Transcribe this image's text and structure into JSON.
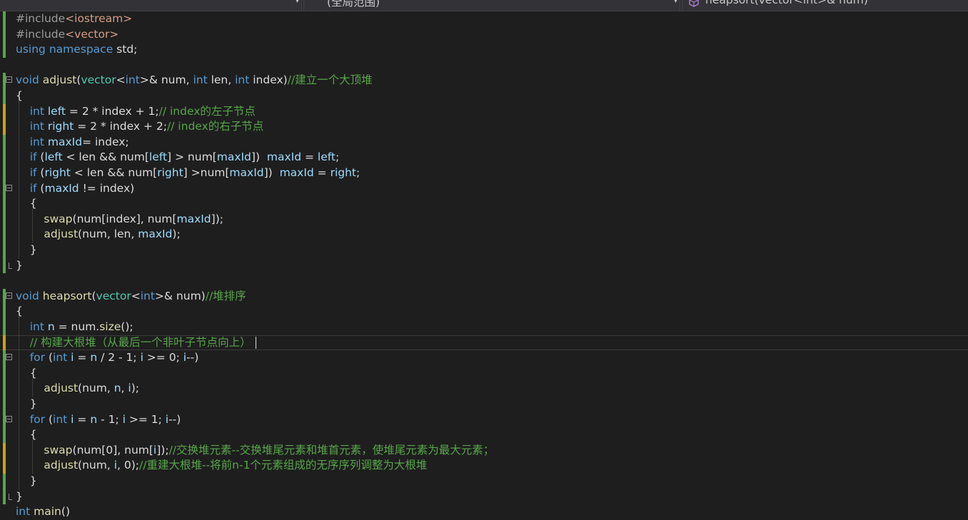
{
  "nav": {
    "scope": "(全局范围)",
    "function": "heapsort(vector<int>& num)"
  },
  "colors": {
    "background": "#1e1e1e",
    "keyword": "#569cd6",
    "type": "#4ec9b0",
    "function": "#dcdcaa",
    "comment": "#57a64a",
    "string": "#d69d85",
    "preprocessor": "#9b9b9b",
    "variable": "#9cdcfe"
  },
  "code_lines": [
    [
      [
        "pp",
        "#include"
      ],
      [
        "st",
        "<iostream>"
      ]
    ],
    [
      [
        "pp",
        "#include"
      ],
      [
        "st",
        "<vector>"
      ]
    ],
    [
      [
        "kw",
        "using"
      ],
      [
        "pl",
        " "
      ],
      [
        "kw",
        "namespace"
      ],
      [
        "pl",
        " std;"
      ]
    ],
    [],
    [
      [
        "kw",
        "void"
      ],
      [
        "pl",
        " "
      ],
      [
        "fn",
        "adjust"
      ],
      [
        "pl",
        "("
      ],
      [
        "ty",
        "vector"
      ],
      [
        "pl",
        "<"
      ],
      [
        "kw",
        "int"
      ],
      [
        "pl",
        ">& num, "
      ],
      [
        "kw",
        "int"
      ],
      [
        "pl",
        " len, "
      ],
      [
        "kw",
        "int"
      ],
      [
        "pl",
        " index)"
      ],
      [
        "cm",
        "//建立一个大顶堆"
      ]
    ],
    [
      [
        "pl",
        "{"
      ]
    ],
    [
      [
        "pl",
        "    "
      ],
      [
        "kw",
        "int"
      ],
      [
        "pl",
        " "
      ],
      [
        "vr",
        "left"
      ],
      [
        "pl",
        " = 2 * index + 1;"
      ],
      [
        "cm",
        "// index的左子节点"
      ]
    ],
    [
      [
        "pl",
        "    "
      ],
      [
        "kw",
        "int"
      ],
      [
        "pl",
        " "
      ],
      [
        "vr",
        "right"
      ],
      [
        "pl",
        " = 2 * index + 2;"
      ],
      [
        "cm",
        "// index的右子节点"
      ]
    ],
    [
      [
        "pl",
        "    "
      ],
      [
        "kw",
        "int"
      ],
      [
        "pl",
        " "
      ],
      [
        "vr",
        "maxId"
      ],
      [
        "pl",
        "= index;"
      ]
    ],
    [
      [
        "pl",
        "    "
      ],
      [
        "kw",
        "if"
      ],
      [
        "pl",
        " ("
      ],
      [
        "vr",
        "left"
      ],
      [
        "pl",
        " < len && num["
      ],
      [
        "vr",
        "left"
      ],
      [
        "pl",
        "] > num["
      ],
      [
        "vr",
        "maxId"
      ],
      [
        "pl",
        "])  "
      ],
      [
        "vr",
        "maxId"
      ],
      [
        "pl",
        " = "
      ],
      [
        "vr",
        "left"
      ],
      [
        "pl",
        ";"
      ]
    ],
    [
      [
        "pl",
        "    "
      ],
      [
        "kw",
        "if"
      ],
      [
        "pl",
        " ("
      ],
      [
        "vr",
        "right"
      ],
      [
        "pl",
        " < len && num["
      ],
      [
        "vr",
        "right"
      ],
      [
        "pl",
        "] >num["
      ],
      [
        "vr",
        "maxId"
      ],
      [
        "pl",
        "])  "
      ],
      [
        "vr",
        "maxId"
      ],
      [
        "pl",
        " = "
      ],
      [
        "vr",
        "right"
      ],
      [
        "pl",
        ";"
      ]
    ],
    [
      [
        "pl",
        "    "
      ],
      [
        "kw",
        "if"
      ],
      [
        "pl",
        " ("
      ],
      [
        "vr",
        "maxId"
      ],
      [
        "pl",
        " != index)"
      ]
    ],
    [
      [
        "pl",
        "    {"
      ]
    ],
    [
      [
        "pl",
        "        "
      ],
      [
        "fn",
        "swap"
      ],
      [
        "pl",
        "(num[index], num["
      ],
      [
        "vr",
        "maxId"
      ],
      [
        "pl",
        "]);"
      ]
    ],
    [
      [
        "pl",
        "        "
      ],
      [
        "fn",
        "adjust"
      ],
      [
        "pl",
        "(num, len, "
      ],
      [
        "vr",
        "maxId"
      ],
      [
        "pl",
        ");"
      ]
    ],
    [
      [
        "pl",
        "    }"
      ]
    ],
    [
      [
        "pl",
        "}"
      ]
    ],
    [],
    [
      [
        "kw",
        "void"
      ],
      [
        "pl",
        " "
      ],
      [
        "fn",
        "heapsort"
      ],
      [
        "pl",
        "("
      ],
      [
        "ty",
        "vector"
      ],
      [
        "pl",
        "<"
      ],
      [
        "kw",
        "int"
      ],
      [
        "pl",
        ">& num)"
      ],
      [
        "cm",
        "//堆排序"
      ]
    ],
    [
      [
        "pl",
        "{"
      ]
    ],
    [
      [
        "pl",
        "    "
      ],
      [
        "kw",
        "int"
      ],
      [
        "pl",
        " "
      ],
      [
        "vr",
        "n"
      ],
      [
        "pl",
        " = num."
      ],
      [
        "fn",
        "size"
      ],
      [
        "pl",
        "();"
      ]
    ],
    [
      [
        "pl",
        "    "
      ],
      [
        "cm",
        "// 构建大根堆（从最后一个非叶子节点向上）"
      ]
    ],
    [
      [
        "pl",
        "    "
      ],
      [
        "kw",
        "for"
      ],
      [
        "pl",
        " ("
      ],
      [
        "kw",
        "int"
      ],
      [
        "pl",
        " "
      ],
      [
        "vr",
        "i"
      ],
      [
        "pl",
        " = "
      ],
      [
        "vr",
        "n"
      ],
      [
        "pl",
        " / 2 - 1; "
      ],
      [
        "vr",
        "i"
      ],
      [
        "pl",
        " >= 0; "
      ],
      [
        "vr",
        "i"
      ],
      [
        "pl",
        "--)"
      ]
    ],
    [
      [
        "pl",
        "    {"
      ]
    ],
    [
      [
        "pl",
        "        "
      ],
      [
        "fn",
        "adjust"
      ],
      [
        "pl",
        "(num, "
      ],
      [
        "vr",
        "n"
      ],
      [
        "pl",
        ", "
      ],
      [
        "vr",
        "i"
      ],
      [
        "pl",
        ");"
      ]
    ],
    [
      [
        "pl",
        "    }"
      ]
    ],
    [
      [
        "pl",
        "    "
      ],
      [
        "kw",
        "for"
      ],
      [
        "pl",
        " ("
      ],
      [
        "kw",
        "int"
      ],
      [
        "pl",
        " "
      ],
      [
        "vr",
        "i"
      ],
      [
        "pl",
        " = "
      ],
      [
        "vr",
        "n"
      ],
      [
        "pl",
        " - 1; "
      ],
      [
        "vr",
        "i"
      ],
      [
        "pl",
        " >= 1; "
      ],
      [
        "vr",
        "i"
      ],
      [
        "pl",
        "--)"
      ]
    ],
    [
      [
        "pl",
        "    {"
      ]
    ],
    [
      [
        "pl",
        "        "
      ],
      [
        "fn",
        "swap"
      ],
      [
        "pl",
        "(num[0], num["
      ],
      [
        "vr",
        "i"
      ],
      [
        "pl",
        "]);"
      ],
      [
        "cm",
        "//交换堆元素--交换堆尾元素和堆首元素，使堆尾元素为最大元素；"
      ]
    ],
    [
      [
        "pl",
        "        "
      ],
      [
        "fn",
        "adjust"
      ],
      [
        "pl",
        "(num, "
      ],
      [
        "vr",
        "i"
      ],
      [
        "pl",
        ", 0);"
      ],
      [
        "cm",
        "//重建大根堆--将前n-1个元素组成的无序序列调整为大根堆"
      ]
    ],
    [
      [
        "pl",
        "    }"
      ]
    ],
    [
      [
        "pl",
        "}"
      ]
    ],
    [
      [
        "kw",
        "int"
      ],
      [
        "pl",
        " "
      ],
      [
        "fn",
        "main"
      ],
      [
        "pl",
        "()"
      ]
    ]
  ]
}
